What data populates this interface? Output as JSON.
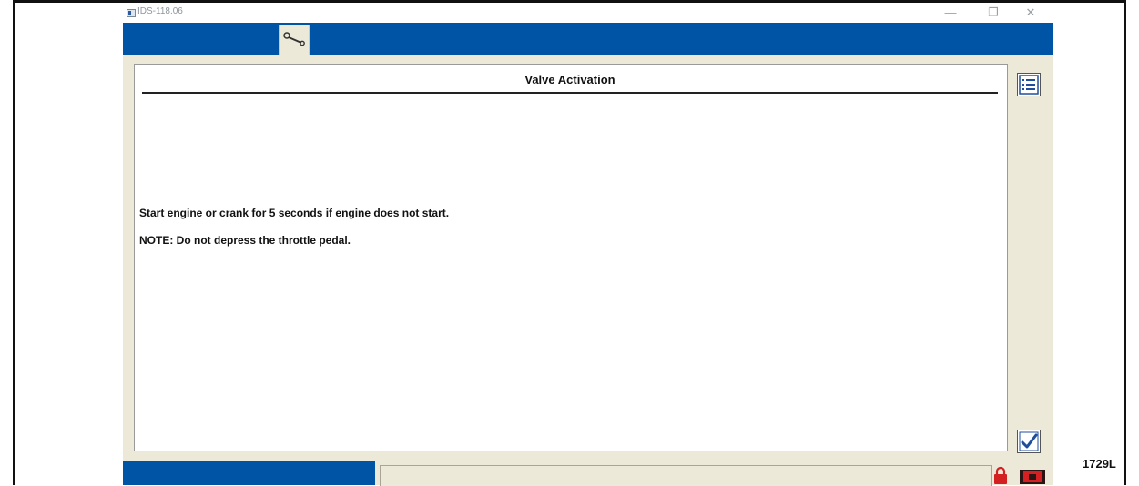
{
  "window": {
    "title": "IDS-118.06",
    "minimize_glyph": "—",
    "maximize_glyph": "❐",
    "close_glyph": "✕"
  },
  "toolbar": {
    "active_tab_icon": "wrench-icon"
  },
  "panel": {
    "title": "Valve Activation",
    "instructions": [
      "Start engine or crank for 5 seconds if engine does not start.",
      "NOTE: Do not depress the throttle pedal."
    ]
  },
  "side_buttons": {
    "top_icon": "list-icon",
    "bottom_icon": "checkmark-icon"
  },
  "statusbar": {
    "icons": [
      "lock-icon",
      "vci-connector-icon"
    ]
  },
  "colors": {
    "accent_blue": "#0054a6",
    "panel_bg": "#ece9d8",
    "lock_red": "#d42020"
  },
  "figure_label": "1729L"
}
